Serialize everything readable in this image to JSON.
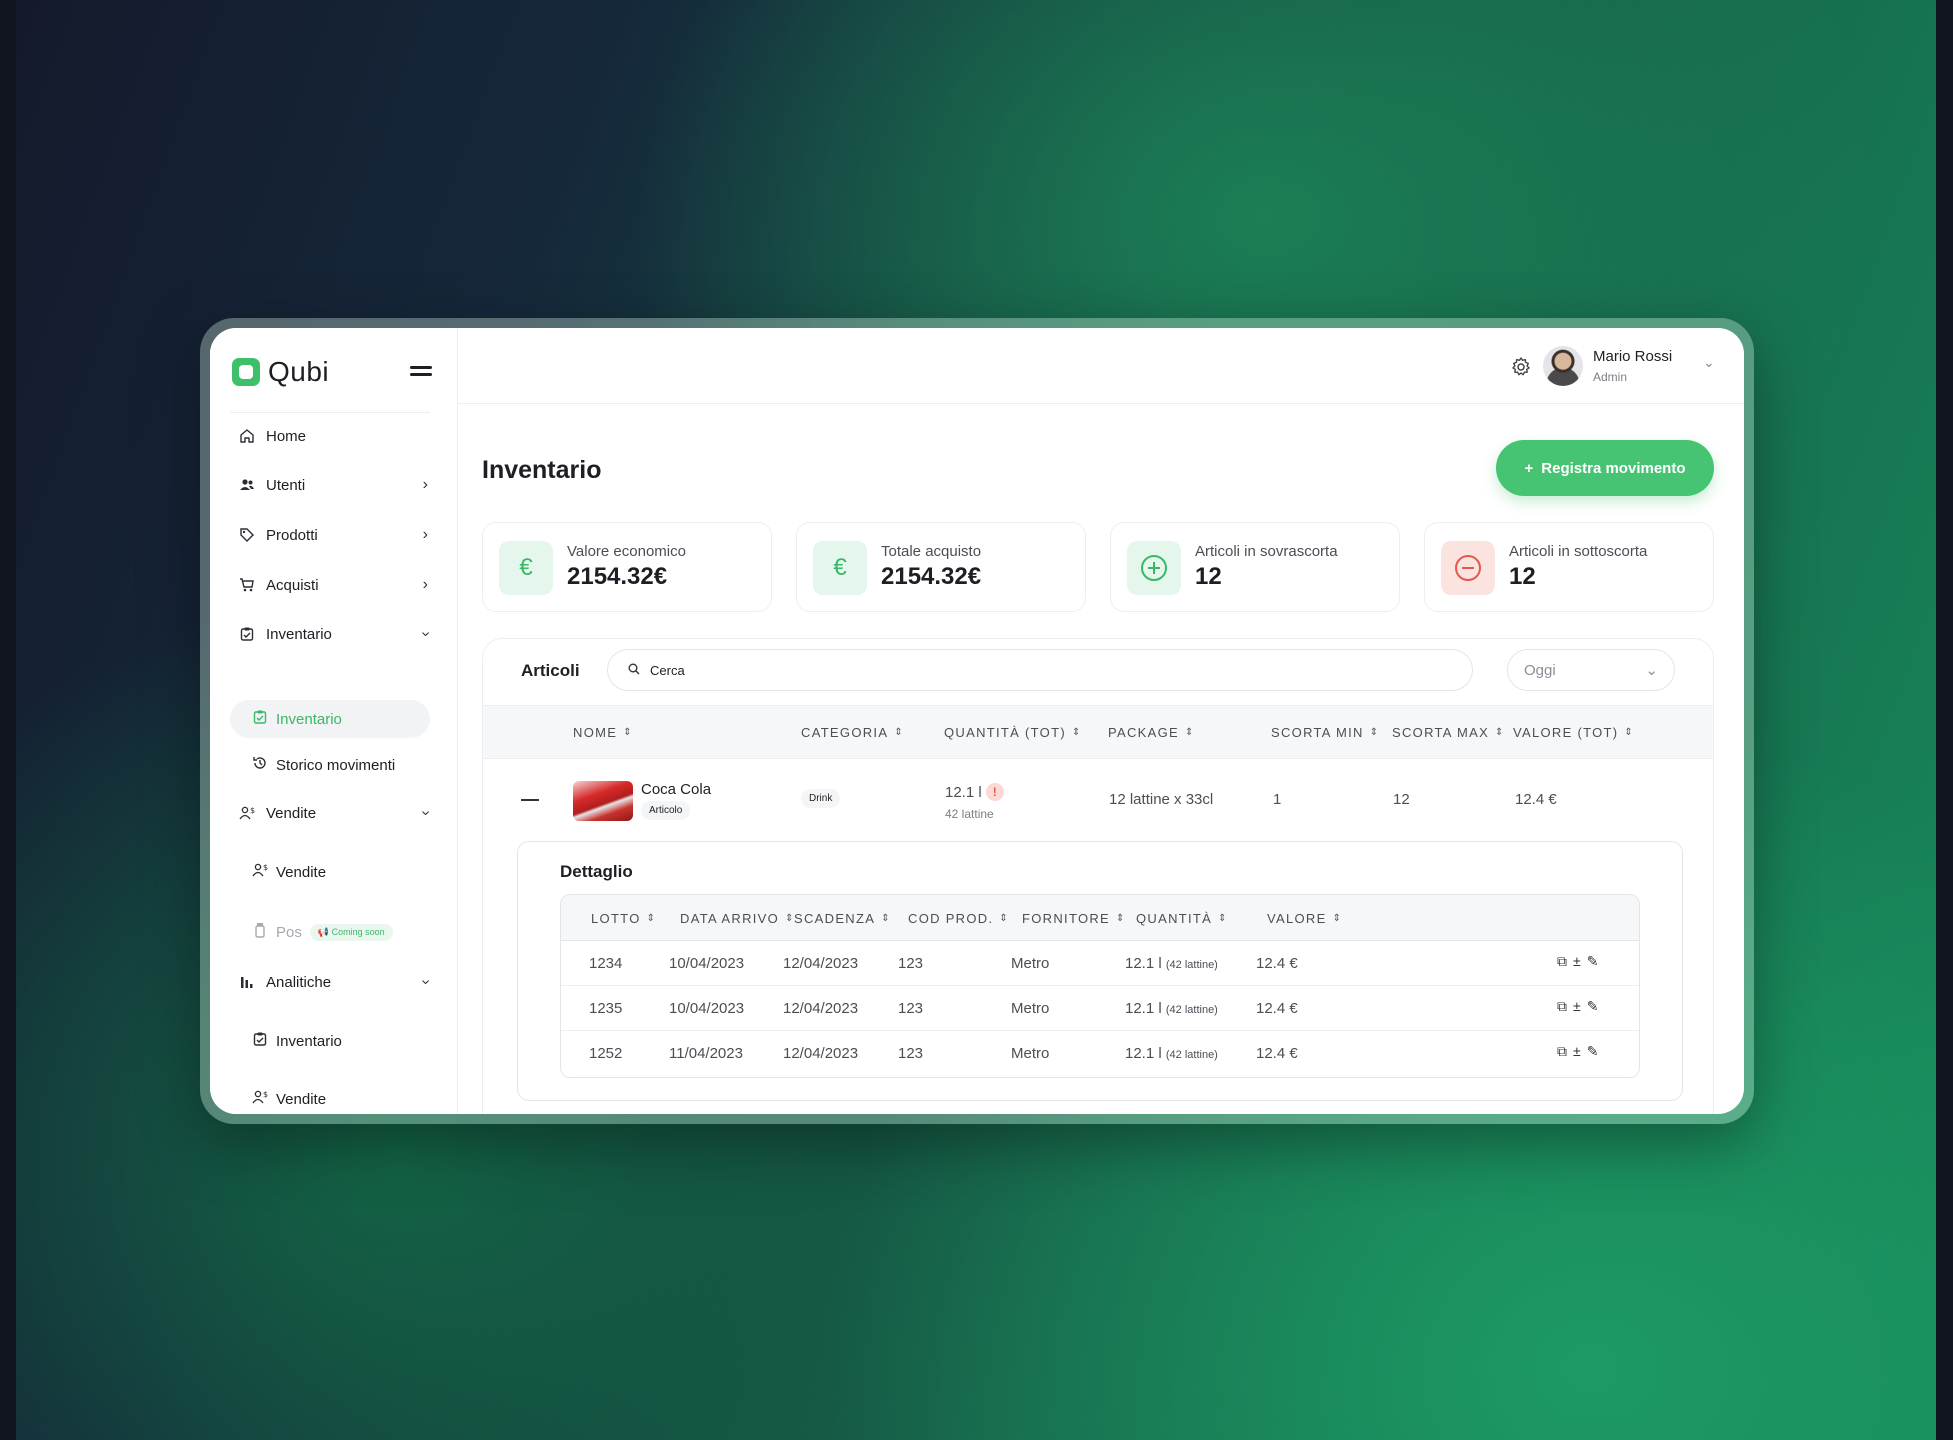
{
  "app": {
    "brand": "Qubi"
  },
  "sidebar": {
    "items": [
      {
        "label": "Home",
        "icon": "home-icon"
      },
      {
        "label": "Utenti",
        "icon": "users-icon"
      },
      {
        "label": "Prodotti",
        "icon": "tag-icon"
      },
      {
        "label": "Acquisti",
        "icon": "cart-icon"
      },
      {
        "label": "Inventario",
        "icon": "clipboard-icon"
      },
      {
        "label": "Vendite",
        "icon": "users-dollar-icon"
      },
      {
        "label": "Analitiche",
        "icon": "bar-chart-icon"
      }
    ],
    "inventario_sub": [
      {
        "label": "Inventario",
        "active": true
      },
      {
        "label": "Storico movimenti"
      }
    ],
    "vendite_sub": [
      {
        "label": "Vendite"
      },
      {
        "label": "Pos",
        "badge": "Coming soon"
      }
    ],
    "analitiche_sub": [
      {
        "label": "Inventario"
      },
      {
        "label": "Vendite"
      }
    ]
  },
  "header": {
    "user_name": "Mario Rossi",
    "user_role": "Admin"
  },
  "main": {
    "title": "Inventario",
    "cta_label": "Registra movimento",
    "cards": [
      {
        "label": "Valore economico",
        "value": "2154.32€",
        "icon": "euro-icon",
        "tone": "green"
      },
      {
        "label": "Totale acquisto",
        "value": "2154.32€",
        "icon": "euro-icon",
        "tone": "green"
      },
      {
        "label": "Articoli in sovrascorta",
        "value": "12",
        "icon": "plus-circle-icon",
        "tone": "green"
      },
      {
        "label": "Articoli in sottoscorta",
        "value": "12",
        "icon": "minus-circle-icon",
        "tone": "red"
      }
    ],
    "articoli": {
      "title": "Articoli",
      "search_value": "Cerca",
      "period": "Oggi",
      "columns": [
        "NOME",
        "CATEGORIA",
        "QUANTITÀ (TOT)",
        "PACKAGE",
        "SCORTA MIN",
        "SCORTA MAX",
        "VALORE (TOT)"
      ],
      "row": {
        "name": "Coca Cola",
        "type": "Articolo",
        "category": "Drink",
        "qty": "12.1 l",
        "qty_warn": "!",
        "qty_sub": "42 lattine",
        "package": "12 lattine x 33cl",
        "min": "1",
        "max": "12",
        "value": "12.4 €"
      }
    },
    "dettaglio": {
      "title": "Dettaglio",
      "columns": [
        "LOTTO",
        "DATA ARRIVO",
        "SCADENZA",
        "COD PROD.",
        "FORNITORE",
        "QUANTITÀ",
        "VALORE"
      ],
      "rows": [
        {
          "lotto": "1234",
          "arrivo": "10/04/2023",
          "scadenza": "12/04/2023",
          "cod": "123",
          "fornitore": "Metro",
          "qty": "12.1 l",
          "qty_sub": "(42 lattine)",
          "valore": "12.4 €"
        },
        {
          "lotto": "1235",
          "arrivo": "10/04/2023",
          "scadenza": "12/04/2023",
          "cod": "123",
          "fornitore": "Metro",
          "qty": "12.1 l",
          "qty_sub": "(42 lattine)",
          "valore": "12.4 €"
        },
        {
          "lotto": "1252",
          "arrivo": "11/04/2023",
          "scadenza": "12/04/2023",
          "cod": "123",
          "fornitore": "Metro",
          "qty": "12.1 l",
          "qty_sub": "(42 lattine)",
          "valore": "12.4 €"
        }
      ]
    }
  },
  "colors": {
    "accent": "#47c473",
    "danger": "#e25a4d"
  }
}
